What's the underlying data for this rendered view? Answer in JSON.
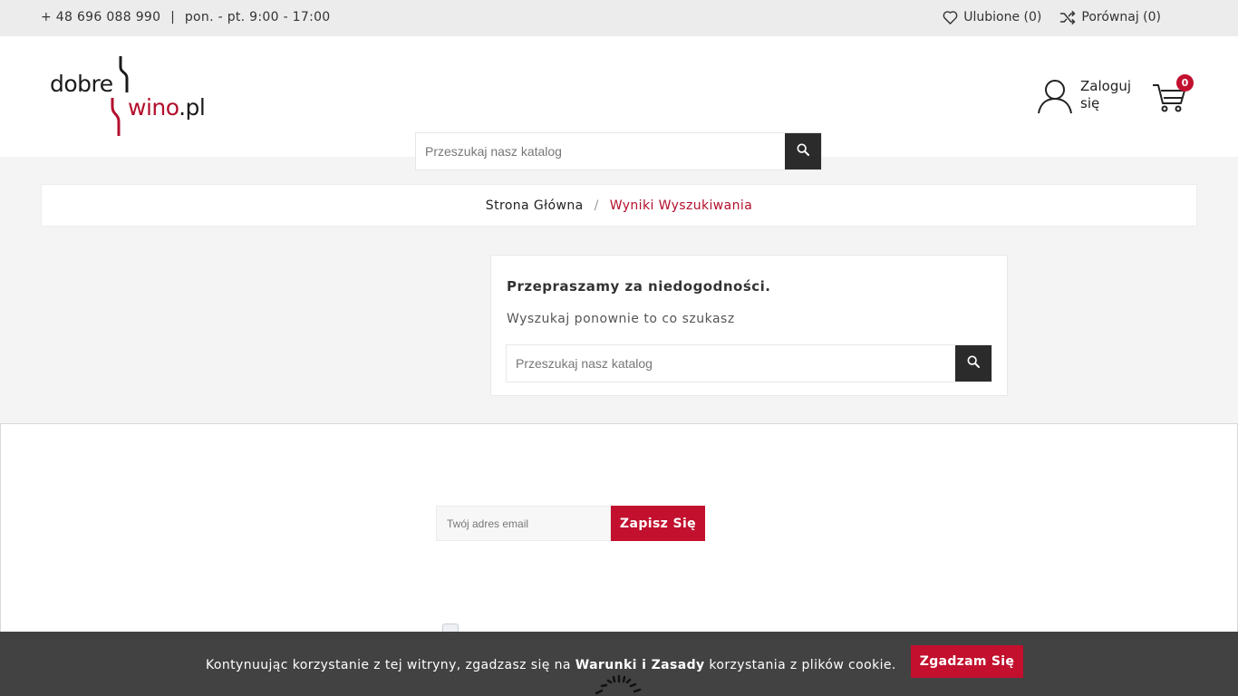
{
  "topbar": {
    "phone": "+ 48 696 088 990",
    "separator": "|",
    "hours": "pon. - pt. 9:00 - 17:00",
    "wishlist_label": "Ulubione (0)",
    "compare_label": "Porównaj (0)"
  },
  "logo": {
    "word_top": "dobre",
    "word_bottom": "wino",
    "word_dot": ".pl",
    "colors": {
      "dark": "#1b1b1b",
      "accent": "#b30f2c"
    }
  },
  "header": {
    "login_label": "Zaloguj się",
    "cart_count": "0",
    "search_placeholder": "Przeszukaj nasz katalog"
  },
  "breadcrumb": {
    "home": "Strona Główna",
    "separator": "/",
    "current": "Wyniki Wyszukiwania"
  },
  "notfound": {
    "title": "Przepraszamy za niedogodności.",
    "subtitle": "Wyszukaj ponownie to co szukasz",
    "search_placeholder": "Przeszukaj nasz katalog"
  },
  "newsletter": {
    "email_placeholder": "Twój adres email",
    "subscribe_label": "Zapisz Się"
  },
  "cookie": {
    "text_before": "Kontynuując korzystanie z tej witryny, zgadzasz się na ",
    "link_text": "Warunki i Zasady",
    "text_after": " korzystania z plików cookie.",
    "accept_label": "Zgadzam Się"
  },
  "colors": {
    "accent": "#c2102e",
    "dark_button": "#2b2b2b",
    "cookie_bar": "#3a3a3a"
  }
}
